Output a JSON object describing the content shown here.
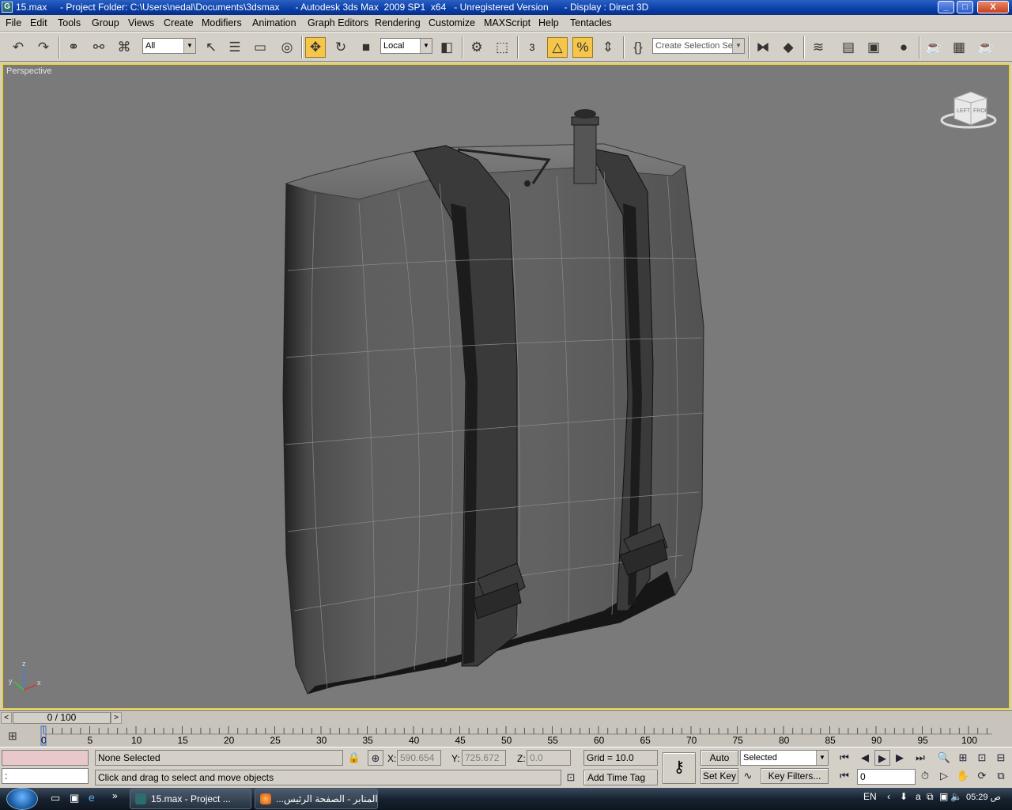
{
  "window": {
    "title": "15.max     - Project Folder: C:\\Users\\nedal\\Documents\\3dsmax      - Autodesk 3ds Max  2009 SP1  x64   - Unregistered Version      - Display : Direct 3D",
    "app_icon_glyph": "G",
    "controls": {
      "minimize": "_",
      "maximize": "□",
      "close": "X"
    }
  },
  "menu": [
    "File",
    "Edit",
    "Tools",
    "Group",
    "Views",
    "Create",
    "Modifiers",
    "Animation",
    "Graph Editors",
    "Rendering",
    "Customize",
    "MAXScript",
    "Help",
    "Tentacles"
  ],
  "toolbar": {
    "selection_filter": "All",
    "ref_coord": "Local",
    "named_selection_placeholder": "Create Selection Set",
    "snap_label": "3",
    "angle_snap_label": "%"
  },
  "viewport": {
    "label": "Perspective",
    "viewcube": {
      "left": "LEFT",
      "front": "FRONT"
    },
    "axis": {
      "x": "x",
      "y": "y",
      "z": "z"
    }
  },
  "timeline": {
    "frame_display": "0 / 100",
    "prev": "<",
    "next": ">",
    "current_frame": 0,
    "ticks": [
      "0",
      "5",
      "10",
      "15",
      "20",
      "25",
      "30",
      "35",
      "40",
      "45",
      "50",
      "55",
      "60",
      "65",
      "70",
      "75",
      "80",
      "85",
      "90",
      "95",
      "100"
    ]
  },
  "status": {
    "maxscript_prompt": ":",
    "selection": "None Selected",
    "prompt": "Click and drag to select and move objects",
    "x_label": "X:",
    "x_value": "590.654",
    "y_label": "Y:",
    "y_value": "725.672",
    "z_label": "Z:",
    "z_value": "0.0",
    "grid": "Grid = 10.0",
    "add_time_tag": "Add Time Tag",
    "auto_key": "Auto Key",
    "set_key": "Set Key",
    "key_mode": "Selected",
    "key_filters": "Key Filters...",
    "frame_spinner": "0"
  },
  "taskbar": {
    "items": [
      {
        "label": "15.max     - Project ..."
      },
      {
        "label": "...المنابر - الصفحة الرئيس"
      }
    ],
    "language": "EN",
    "clock": "05:29 ص",
    "chevron": "»"
  },
  "colors": {
    "viewport_bg": "#7a7a7a",
    "viewport_border": "#e8d23a",
    "active_tool": "#f5c64a",
    "titlebar": "#0a3fa8"
  }
}
